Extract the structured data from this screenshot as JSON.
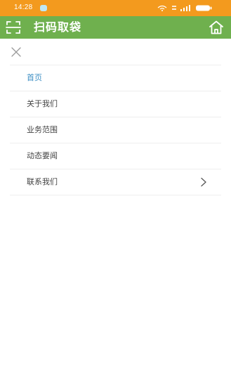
{
  "status_bar": {
    "time": "14:28",
    "background_color": "#f39a1e"
  },
  "header": {
    "title": "扫码取袋",
    "left_icon": "scan-icon",
    "right_icon": "home-icon",
    "background_color": "#6fb04e"
  },
  "drawer": {
    "close_icon": "close-icon",
    "items": [
      {
        "label": "首页",
        "active": true
      },
      {
        "label": "关于我们",
        "active": false
      },
      {
        "label": "业务范围",
        "active": false
      },
      {
        "label": "动态要闻",
        "active": false
      },
      {
        "label": "联系我们",
        "active": false,
        "has_chevron": true
      }
    ],
    "active_color": "#3d8fc4"
  }
}
